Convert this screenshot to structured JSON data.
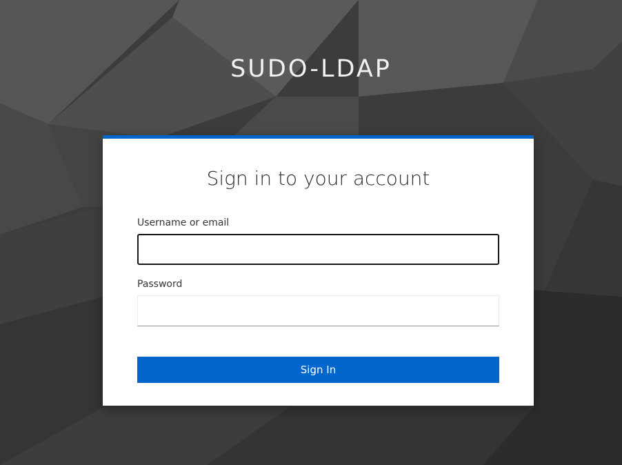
{
  "realm": {
    "title": "SUDO-LDAP"
  },
  "login_card": {
    "accent_color": "#0066cc",
    "title": "Sign in to your account",
    "username": {
      "label": "Username or email",
      "value": "",
      "placeholder": ""
    },
    "password": {
      "label": "Password",
      "value": "",
      "placeholder": ""
    },
    "submit_label": "Sign In"
  }
}
